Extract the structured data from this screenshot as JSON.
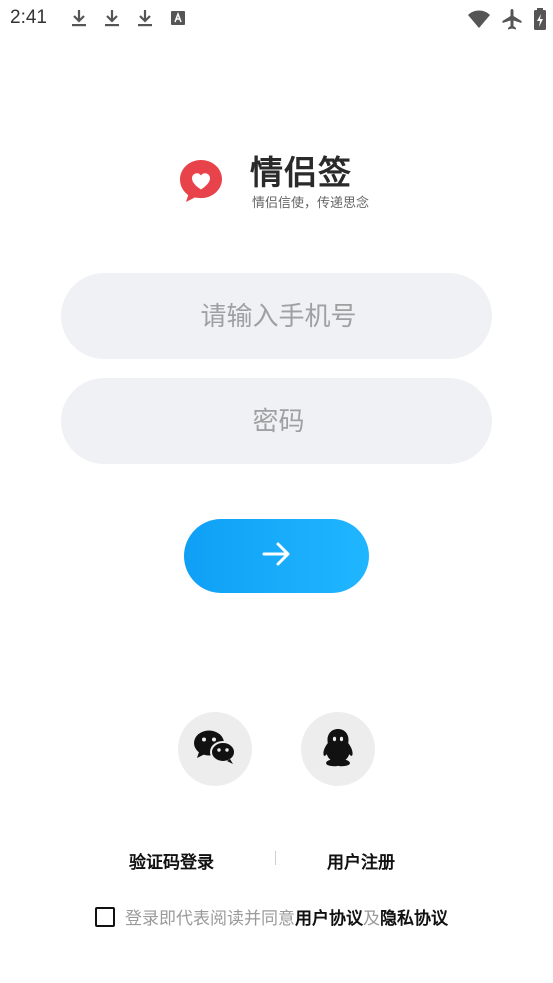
{
  "status_bar": {
    "time": "2:41",
    "left_icons": [
      "download-icon",
      "download-icon",
      "download-icon",
      "text-notification-icon"
    ],
    "right_icons": [
      "wifi-icon",
      "airplane-mode-icon",
      "battery-charging-icon"
    ]
  },
  "brand": {
    "name": "情侣签",
    "slogan": "情侣信使，传递思念",
    "logo_color": "#e8434a"
  },
  "form": {
    "phone_placeholder": "请输入手机号",
    "phone_value": "",
    "password_placeholder": "密码",
    "password_value": ""
  },
  "submit": {
    "icon": "arrow-right-icon",
    "color": "#1aaaf8"
  },
  "social_login": {
    "items": [
      "wechat-icon",
      "qq-icon"
    ]
  },
  "links": {
    "sms_login": "验证码登录",
    "register": "用户注册"
  },
  "agreement": {
    "checked": false,
    "prefix": "登录即代表阅读并同意",
    "user_agreement": "用户协议",
    "conjunction": "及",
    "privacy_policy": "隐私协议"
  }
}
